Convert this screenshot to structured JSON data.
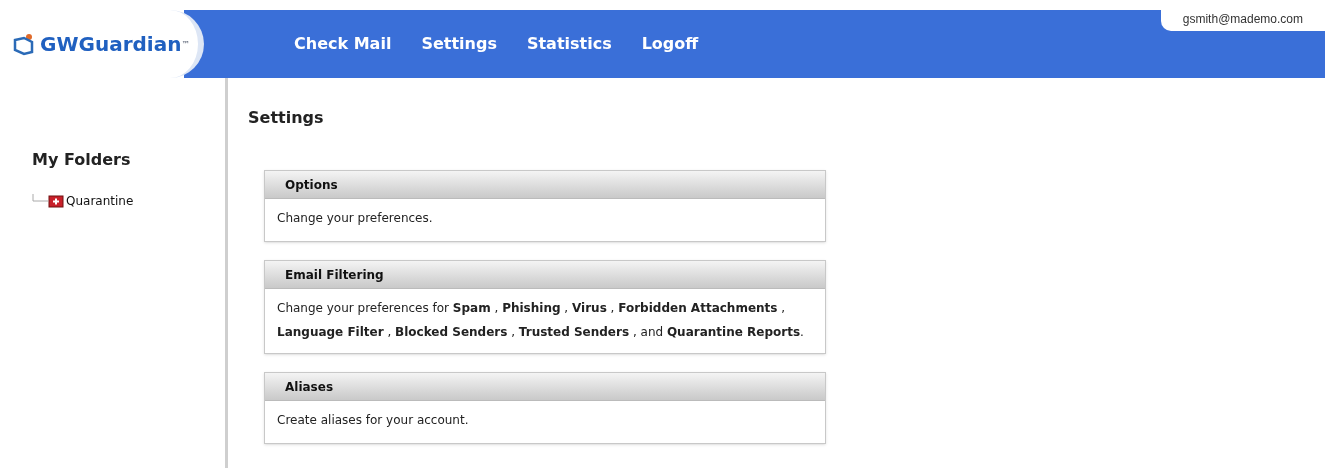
{
  "logo": {
    "text": "GWGuardian",
    "mark": "™"
  },
  "nav": [
    {
      "label": "Check Mail"
    },
    {
      "label": "Settings"
    },
    {
      "label": "Statistics"
    },
    {
      "label": "Logoff"
    }
  ],
  "user_email": "gsmith@mademo.com",
  "sidebar": {
    "title": "My Folders",
    "items": [
      {
        "label": "Quarantine"
      }
    ]
  },
  "page_title": "Settings",
  "panels": [
    {
      "title": "Options",
      "text": "Change your preferences."
    },
    {
      "title": "Email Filtering",
      "text": "Change your preferences for **Spam** , **Phishing** , **Virus** , **Forbidden Attachments** , **Language Filter** , **Blocked Senders** , **Trusted Senders** , and **Quarantine Reports**."
    },
    {
      "title": "Aliases",
      "text": "Create aliases for your account."
    }
  ]
}
